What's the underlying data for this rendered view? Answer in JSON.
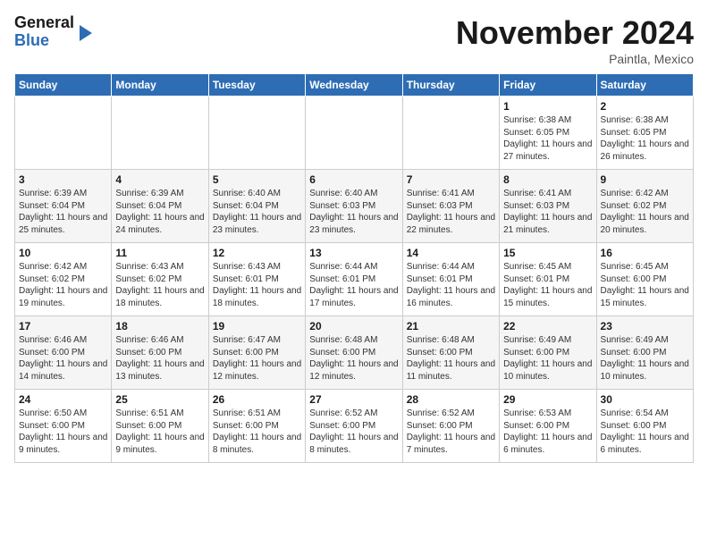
{
  "header": {
    "logo_line1": "General",
    "logo_line2": "Blue",
    "month": "November 2024",
    "location": "Paintla, Mexico"
  },
  "days_of_week": [
    "Sunday",
    "Monday",
    "Tuesday",
    "Wednesday",
    "Thursday",
    "Friday",
    "Saturday"
  ],
  "weeks": [
    [
      {
        "day": "",
        "text": ""
      },
      {
        "day": "",
        "text": ""
      },
      {
        "day": "",
        "text": ""
      },
      {
        "day": "",
        "text": ""
      },
      {
        "day": "",
        "text": ""
      },
      {
        "day": "1",
        "text": "Sunrise: 6:38 AM\nSunset: 6:05 PM\nDaylight: 11 hours and 27 minutes."
      },
      {
        "day": "2",
        "text": "Sunrise: 6:38 AM\nSunset: 6:05 PM\nDaylight: 11 hours and 26 minutes."
      }
    ],
    [
      {
        "day": "3",
        "text": "Sunrise: 6:39 AM\nSunset: 6:04 PM\nDaylight: 11 hours and 25 minutes."
      },
      {
        "day": "4",
        "text": "Sunrise: 6:39 AM\nSunset: 6:04 PM\nDaylight: 11 hours and 24 minutes."
      },
      {
        "day": "5",
        "text": "Sunrise: 6:40 AM\nSunset: 6:04 PM\nDaylight: 11 hours and 23 minutes."
      },
      {
        "day": "6",
        "text": "Sunrise: 6:40 AM\nSunset: 6:03 PM\nDaylight: 11 hours and 23 minutes."
      },
      {
        "day": "7",
        "text": "Sunrise: 6:41 AM\nSunset: 6:03 PM\nDaylight: 11 hours and 22 minutes."
      },
      {
        "day": "8",
        "text": "Sunrise: 6:41 AM\nSunset: 6:03 PM\nDaylight: 11 hours and 21 minutes."
      },
      {
        "day": "9",
        "text": "Sunrise: 6:42 AM\nSunset: 6:02 PM\nDaylight: 11 hours and 20 minutes."
      }
    ],
    [
      {
        "day": "10",
        "text": "Sunrise: 6:42 AM\nSunset: 6:02 PM\nDaylight: 11 hours and 19 minutes."
      },
      {
        "day": "11",
        "text": "Sunrise: 6:43 AM\nSunset: 6:02 PM\nDaylight: 11 hours and 18 minutes."
      },
      {
        "day": "12",
        "text": "Sunrise: 6:43 AM\nSunset: 6:01 PM\nDaylight: 11 hours and 18 minutes."
      },
      {
        "day": "13",
        "text": "Sunrise: 6:44 AM\nSunset: 6:01 PM\nDaylight: 11 hours and 17 minutes."
      },
      {
        "day": "14",
        "text": "Sunrise: 6:44 AM\nSunset: 6:01 PM\nDaylight: 11 hours and 16 minutes."
      },
      {
        "day": "15",
        "text": "Sunrise: 6:45 AM\nSunset: 6:01 PM\nDaylight: 11 hours and 15 minutes."
      },
      {
        "day": "16",
        "text": "Sunrise: 6:45 AM\nSunset: 6:00 PM\nDaylight: 11 hours and 15 minutes."
      }
    ],
    [
      {
        "day": "17",
        "text": "Sunrise: 6:46 AM\nSunset: 6:00 PM\nDaylight: 11 hours and 14 minutes."
      },
      {
        "day": "18",
        "text": "Sunrise: 6:46 AM\nSunset: 6:00 PM\nDaylight: 11 hours and 13 minutes."
      },
      {
        "day": "19",
        "text": "Sunrise: 6:47 AM\nSunset: 6:00 PM\nDaylight: 11 hours and 12 minutes."
      },
      {
        "day": "20",
        "text": "Sunrise: 6:48 AM\nSunset: 6:00 PM\nDaylight: 11 hours and 12 minutes."
      },
      {
        "day": "21",
        "text": "Sunrise: 6:48 AM\nSunset: 6:00 PM\nDaylight: 11 hours and 11 minutes."
      },
      {
        "day": "22",
        "text": "Sunrise: 6:49 AM\nSunset: 6:00 PM\nDaylight: 11 hours and 10 minutes."
      },
      {
        "day": "23",
        "text": "Sunrise: 6:49 AM\nSunset: 6:00 PM\nDaylight: 11 hours and 10 minutes."
      }
    ],
    [
      {
        "day": "24",
        "text": "Sunrise: 6:50 AM\nSunset: 6:00 PM\nDaylight: 11 hours and 9 minutes."
      },
      {
        "day": "25",
        "text": "Sunrise: 6:51 AM\nSunset: 6:00 PM\nDaylight: 11 hours and 9 minutes."
      },
      {
        "day": "26",
        "text": "Sunrise: 6:51 AM\nSunset: 6:00 PM\nDaylight: 11 hours and 8 minutes."
      },
      {
        "day": "27",
        "text": "Sunrise: 6:52 AM\nSunset: 6:00 PM\nDaylight: 11 hours and 8 minutes."
      },
      {
        "day": "28",
        "text": "Sunrise: 6:52 AM\nSunset: 6:00 PM\nDaylight: 11 hours and 7 minutes."
      },
      {
        "day": "29",
        "text": "Sunrise: 6:53 AM\nSunset: 6:00 PM\nDaylight: 11 hours and 6 minutes."
      },
      {
        "day": "30",
        "text": "Sunrise: 6:54 AM\nSunset: 6:00 PM\nDaylight: 11 hours and 6 minutes."
      }
    ]
  ]
}
